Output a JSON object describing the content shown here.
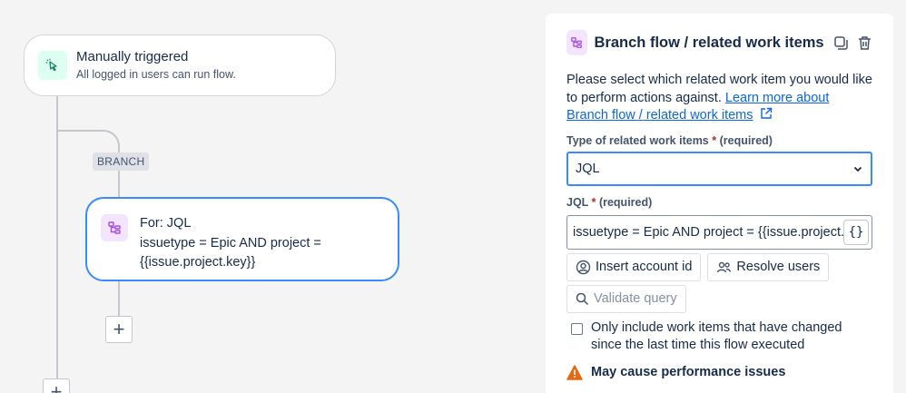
{
  "canvas": {
    "trigger": {
      "icon": "cursor-click-icon",
      "title": "Manually triggered",
      "subtitle": "All logged in users can run flow."
    },
    "branch_pill": "BRANCH",
    "branch_card": {
      "icon": "branch-flow-icon",
      "line1": "For: JQL",
      "line2": "issuetype = Epic AND project =",
      "line3": "{{issue.project.key}}"
    },
    "add_button_label": "+"
  },
  "panel": {
    "icon": "branch-flow-icon",
    "title": "Branch flow / related work items",
    "description": "Please select which related work item you would like to perform actions against. ",
    "learn_more_link": "Learn more about Branch flow / related work items",
    "type_field": {
      "label": "Type of related work items",
      "required_star": "*",
      "required_text": "(required)",
      "value": "JQL"
    },
    "jql_field": {
      "label": "JQL",
      "required_star": "*",
      "required_text": "(required)",
      "value": "issuetype = Epic AND project = {{issue.project.key}}",
      "brace_label": "{}"
    },
    "insert_account_id": "Insert account id",
    "resolve_users": "Resolve users",
    "validate_query": "Validate query",
    "checkbox_label": "Only include work items that have changed since the last time this flow executed",
    "warning": "May cause performance issues"
  },
  "colors": {
    "accent": "#388bff",
    "link": "#0c66e4",
    "warning": "#e56910",
    "trigger_bg": "#dcfff1",
    "branch_bg": "#f3e5ff"
  }
}
